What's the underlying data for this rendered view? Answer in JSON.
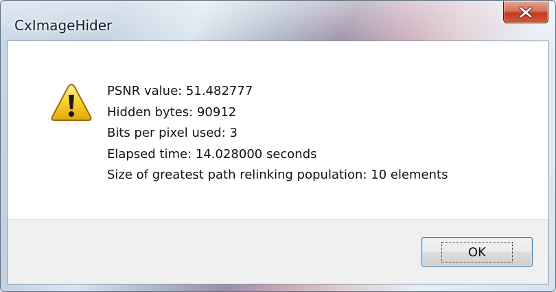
{
  "window": {
    "title": "CxImageHider",
    "close_label": "X"
  },
  "message": {
    "icon": "warning-icon",
    "lines": [
      "PSNR value: 51.482777",
      "Hidden bytes: 90912",
      "Bits per pixel used: 3",
      "Elapsed time: 14.028000 seconds",
      "Size of greatest path relinking population: 10 elements"
    ]
  },
  "buttons": {
    "ok_label": "OK"
  },
  "colors": {
    "close_button": "#c7402a",
    "warning_fill": "#f8d12b",
    "ok_border": "#3c7fb1"
  }
}
